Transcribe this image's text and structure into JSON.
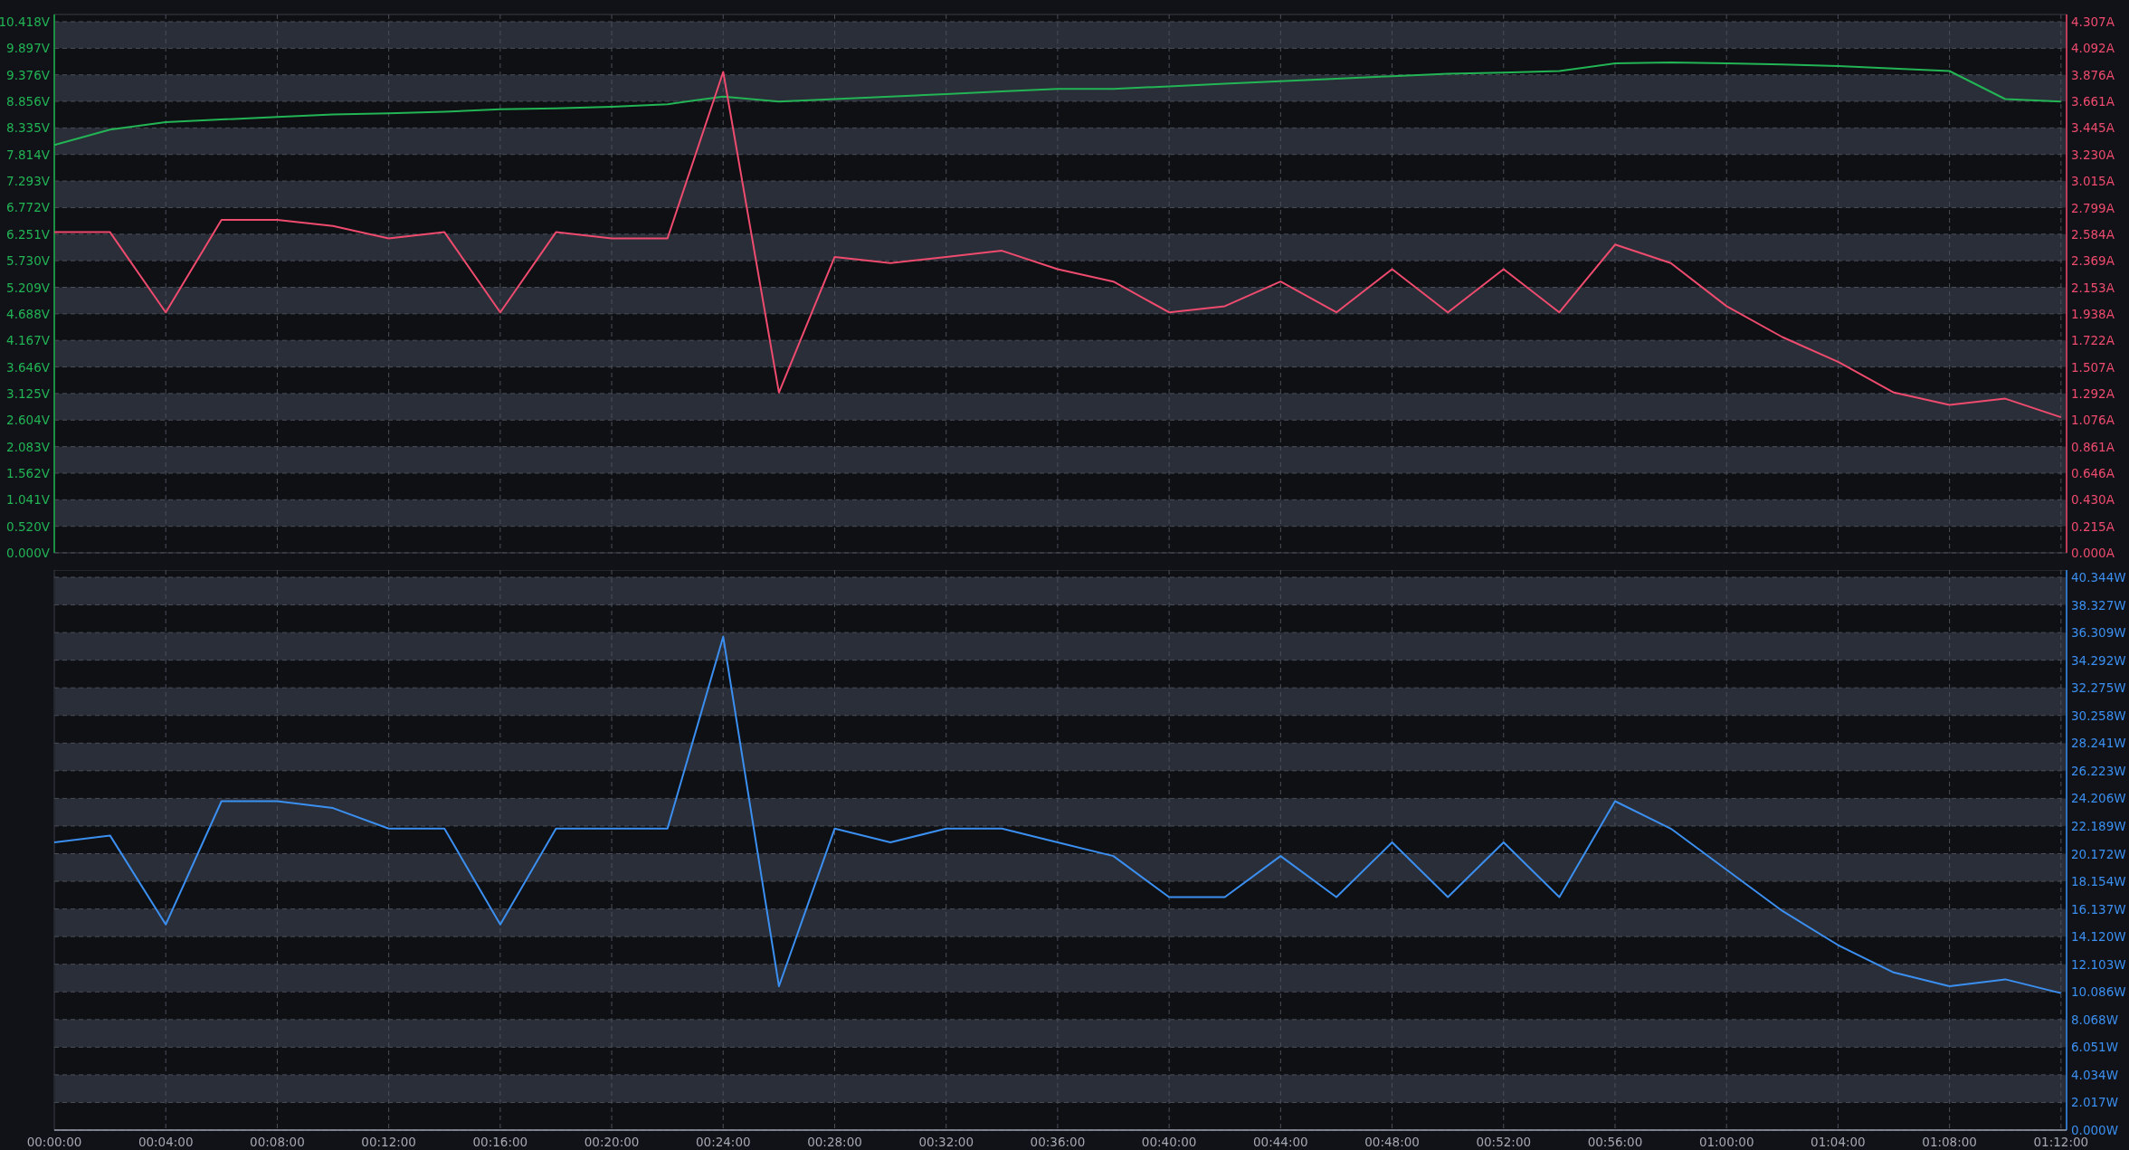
{
  "charts": [
    {
      "chart_data": {
        "type": "line",
        "xlim": [
          0,
          72.2
        ],
        "ylim": [
          0,
          10.418
        ],
        "y2lim": [
          0,
          4.307
        ],
        "grid": true,
        "x": [
          0,
          2,
          4,
          6,
          8,
          10,
          12,
          14,
          16,
          18,
          20,
          22,
          24,
          26,
          28,
          30,
          32,
          34,
          36,
          38,
          40,
          42,
          44,
          46,
          48,
          50,
          52,
          54,
          56,
          58,
          60,
          62,
          64,
          66,
          68,
          70,
          72
        ],
        "yticks": [
          {
            "value": 10.418,
            "label": "10.418V"
          },
          {
            "value": 9.897,
            "label": "9.897V"
          },
          {
            "value": 9.376,
            "label": "9.376V"
          },
          {
            "value": 8.856,
            "label": "8.856V"
          },
          {
            "value": 8.335,
            "label": "8.335V"
          },
          {
            "value": 7.814,
            "label": "7.814V"
          },
          {
            "value": 7.293,
            "label": "7.293V"
          },
          {
            "value": 6.772,
            "label": "6.772V"
          },
          {
            "value": 6.251,
            "label": "6.251V"
          },
          {
            "value": 5.73,
            "label": "5.730V"
          },
          {
            "value": 5.209,
            "label": "5.209V"
          },
          {
            "value": 4.688,
            "label": "4.688V"
          },
          {
            "value": 4.167,
            "label": "4.167V"
          },
          {
            "value": 3.646,
            "label": "3.646V"
          },
          {
            "value": 3.125,
            "label": "3.125V"
          },
          {
            "value": 2.604,
            "label": "2.604V"
          },
          {
            "value": 2.083,
            "label": "2.083V"
          },
          {
            "value": 1.562,
            "label": "1.562V"
          },
          {
            "value": 1.041,
            "label": "1.041V"
          },
          {
            "value": 0.52,
            "label": "0.520V"
          },
          {
            "value": 0,
            "label": "0.000V"
          }
        ],
        "y2ticks": [
          {
            "value": 4.307,
            "label": "4.307A"
          },
          {
            "value": 4.092,
            "label": "4.092A"
          },
          {
            "value": 3.876,
            "label": "3.876A"
          },
          {
            "value": 3.661,
            "label": "3.661A"
          },
          {
            "value": 3.445,
            "label": "3.445A"
          },
          {
            "value": 3.23,
            "label": "3.230A"
          },
          {
            "value": 3.015,
            "label": "3.015A"
          },
          {
            "value": 2.799,
            "label": "2.799A"
          },
          {
            "value": 2.584,
            "label": "2.584A"
          },
          {
            "value": 2.369,
            "label": "2.369A"
          },
          {
            "value": 2.153,
            "label": "2.153A"
          },
          {
            "value": 1.938,
            "label": "1.938A"
          },
          {
            "value": 1.722,
            "label": "1.722A"
          },
          {
            "value": 1.507,
            "label": "1.507A"
          },
          {
            "value": 1.292,
            "label": "1.292A"
          },
          {
            "value": 1.076,
            "label": "1.076A"
          },
          {
            "value": 0.861,
            "label": "0.861A"
          },
          {
            "value": 0.646,
            "label": "0.646A"
          },
          {
            "value": 0.43,
            "label": "0.430A"
          },
          {
            "value": 0.215,
            "label": "0.215A"
          },
          {
            "value": 0,
            "label": "0.000A"
          }
        ],
        "series": [
          {
            "axis": "y",
            "color": "#22b455",
            "values": [
              8.0,
              8.3,
              8.45,
              8.5,
              8.55,
              8.6,
              8.62,
              8.65,
              8.7,
              8.72,
              8.75,
              8.8,
              8.95,
              8.85,
              8.9,
              8.95,
              9.0,
              9.05,
              9.1,
              9.1,
              9.15,
              9.2,
              9.25,
              9.3,
              9.35,
              9.4,
              9.42,
              9.45,
              9.6,
              9.62,
              9.6,
              9.58,
              9.55,
              9.5,
              9.45,
              8.9,
              8.85
            ]
          },
          {
            "axis": "y2",
            "color": "#ee4b6e",
            "values": [
              2.6,
              2.6,
              1.95,
              2.7,
              2.7,
              2.65,
              2.55,
              2.6,
              1.95,
              2.6,
              2.55,
              2.55,
              3.9,
              1.3,
              2.4,
              2.35,
              2.4,
              2.45,
              2.3,
              2.2,
              1.95,
              2.0,
              2.2,
              1.95,
              2.3,
              1.95,
              2.3,
              1.95,
              2.5,
              2.35,
              2.0,
              1.75,
              1.55,
              1.3,
              1.2,
              1.25,
              1.1
            ]
          }
        ]
      }
    },
    {
      "chart_data": {
        "type": "line",
        "xlim": [
          0,
          72.2
        ],
        "y2lim": [
          0,
          40.344
        ],
        "grid": true,
        "x": [
          0,
          2,
          4,
          6,
          8,
          10,
          12,
          14,
          16,
          18,
          20,
          22,
          24,
          26,
          28,
          30,
          32,
          34,
          36,
          38,
          40,
          42,
          44,
          46,
          48,
          50,
          52,
          54,
          56,
          58,
          60,
          62,
          64,
          66,
          68,
          70,
          72
        ],
        "xticks": [
          {
            "value": 0,
            "label": "00:00:00"
          },
          {
            "value": 4,
            "label": "00:04:00"
          },
          {
            "value": 8,
            "label": "00:08:00"
          },
          {
            "value": 12,
            "label": "00:12:00"
          },
          {
            "value": 16,
            "label": "00:16:00"
          },
          {
            "value": 20,
            "label": "00:20:00"
          },
          {
            "value": 24,
            "label": "00:24:00"
          },
          {
            "value": 28,
            "label": "00:28:00"
          },
          {
            "value": 32,
            "label": "00:32:00"
          },
          {
            "value": 36,
            "label": "00:36:00"
          },
          {
            "value": 40,
            "label": "00:40:00"
          },
          {
            "value": 44,
            "label": "00:44:00"
          },
          {
            "value": 48,
            "label": "00:48:00"
          },
          {
            "value": 52,
            "label": "00:52:00"
          },
          {
            "value": 56,
            "label": "00:56:00"
          },
          {
            "value": 60,
            "label": "01:00:00"
          },
          {
            "value": 64,
            "label": "01:04:00"
          },
          {
            "value": 68,
            "label": "01:08:00"
          },
          {
            "value": 72,
            "label": "01:12:00"
          }
        ],
        "y2ticks": [
          {
            "value": 40.344,
            "label": "40.344W"
          },
          {
            "value": 38.327,
            "label": "38.327W"
          },
          {
            "value": 36.309,
            "label": "36.309W"
          },
          {
            "value": 34.292,
            "label": "34.292W"
          },
          {
            "value": 32.275,
            "label": "32.275W"
          },
          {
            "value": 30.258,
            "label": "30.258W"
          },
          {
            "value": 28.241,
            "label": "28.241W"
          },
          {
            "value": 26.223,
            "label": "26.223W"
          },
          {
            "value": 24.206,
            "label": "24.206W"
          },
          {
            "value": 22.189,
            "label": "22.189W"
          },
          {
            "value": 20.172,
            "label": "20.172W"
          },
          {
            "value": 18.154,
            "label": "18.154W"
          },
          {
            "value": 16.137,
            "label": "16.137W"
          },
          {
            "value": 14.12,
            "label": "14.120W"
          },
          {
            "value": 12.103,
            "label": "12.103W"
          },
          {
            "value": 10.086,
            "label": "10.086W"
          },
          {
            "value": 8.068,
            "label": "8.068W"
          },
          {
            "value": 6.051,
            "label": "6.051W"
          },
          {
            "value": 4.034,
            "label": "4.034W"
          },
          {
            "value": 2.017,
            "label": "2.017W"
          },
          {
            "value": 0,
            "label": "0.000W"
          }
        ],
        "series": [
          {
            "axis": "y2",
            "color": "#3b8ff0",
            "values": [
              21,
              21.5,
              15,
              24,
              24,
              23.5,
              22,
              22,
              15,
              22,
              22,
              22,
              36,
              10.5,
              22,
              21,
              22,
              22,
              21,
              20,
              17,
              17,
              20,
              17,
              21,
              17,
              21,
              17,
              24,
              22,
              19,
              16,
              13.5,
              11.5,
              10.5,
              11,
              10
            ]
          }
        ]
      }
    }
  ]
}
